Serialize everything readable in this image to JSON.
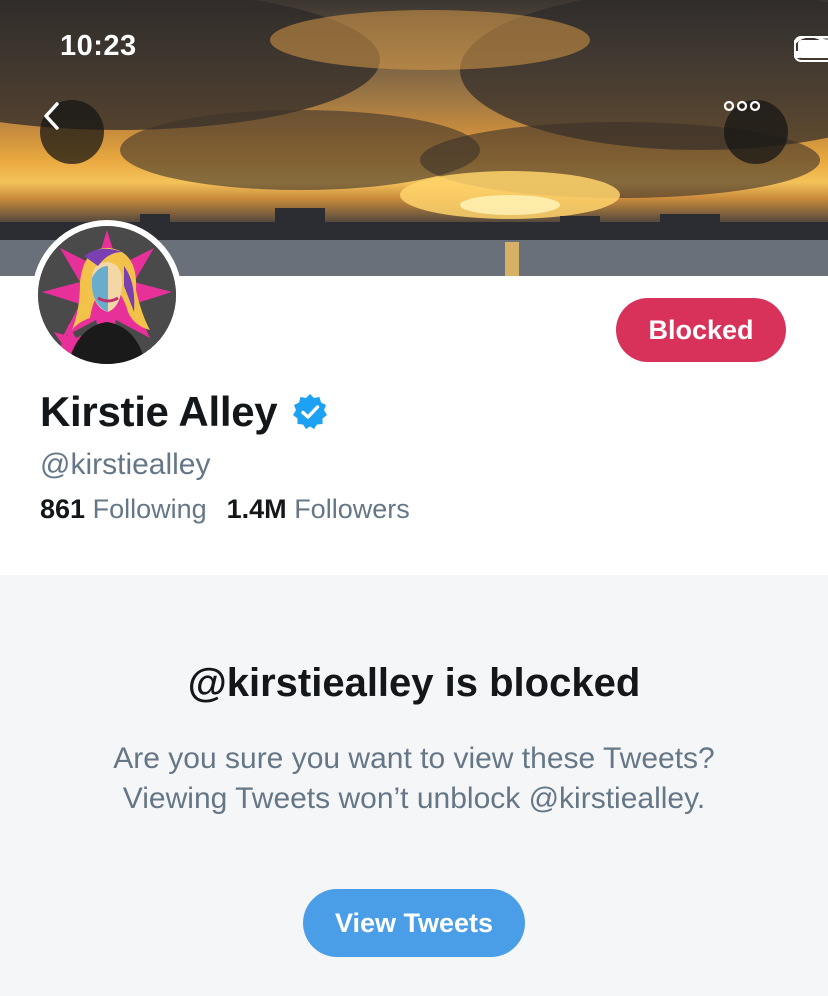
{
  "status_bar": {
    "time": "10:23"
  },
  "profile": {
    "display_name": "Kirstie Alley",
    "handle": "@kirstiealley",
    "verified": true,
    "following_count": "861",
    "following_label": "Following",
    "followers_count": "1.4M",
    "followers_label": "Followers",
    "blocked_button_label": "Blocked"
  },
  "blocked_notice": {
    "title": "@kirstiealley is blocked",
    "description": "Are you sure you want to view these Tweets? Viewing Tweets won’t unblock @kirstiealley.",
    "view_button_label": "View Tweets"
  },
  "colors": {
    "blocked_red": "#d9325a",
    "twitter_blue": "#4a9ee8",
    "verified_blue": "#1da1f2",
    "secondary_text": "#657786"
  },
  "icons": [
    "back-chevron-icon",
    "more-options-icon",
    "verified-badge-icon",
    "signal-icon",
    "wifi-icon",
    "battery-icon"
  ]
}
